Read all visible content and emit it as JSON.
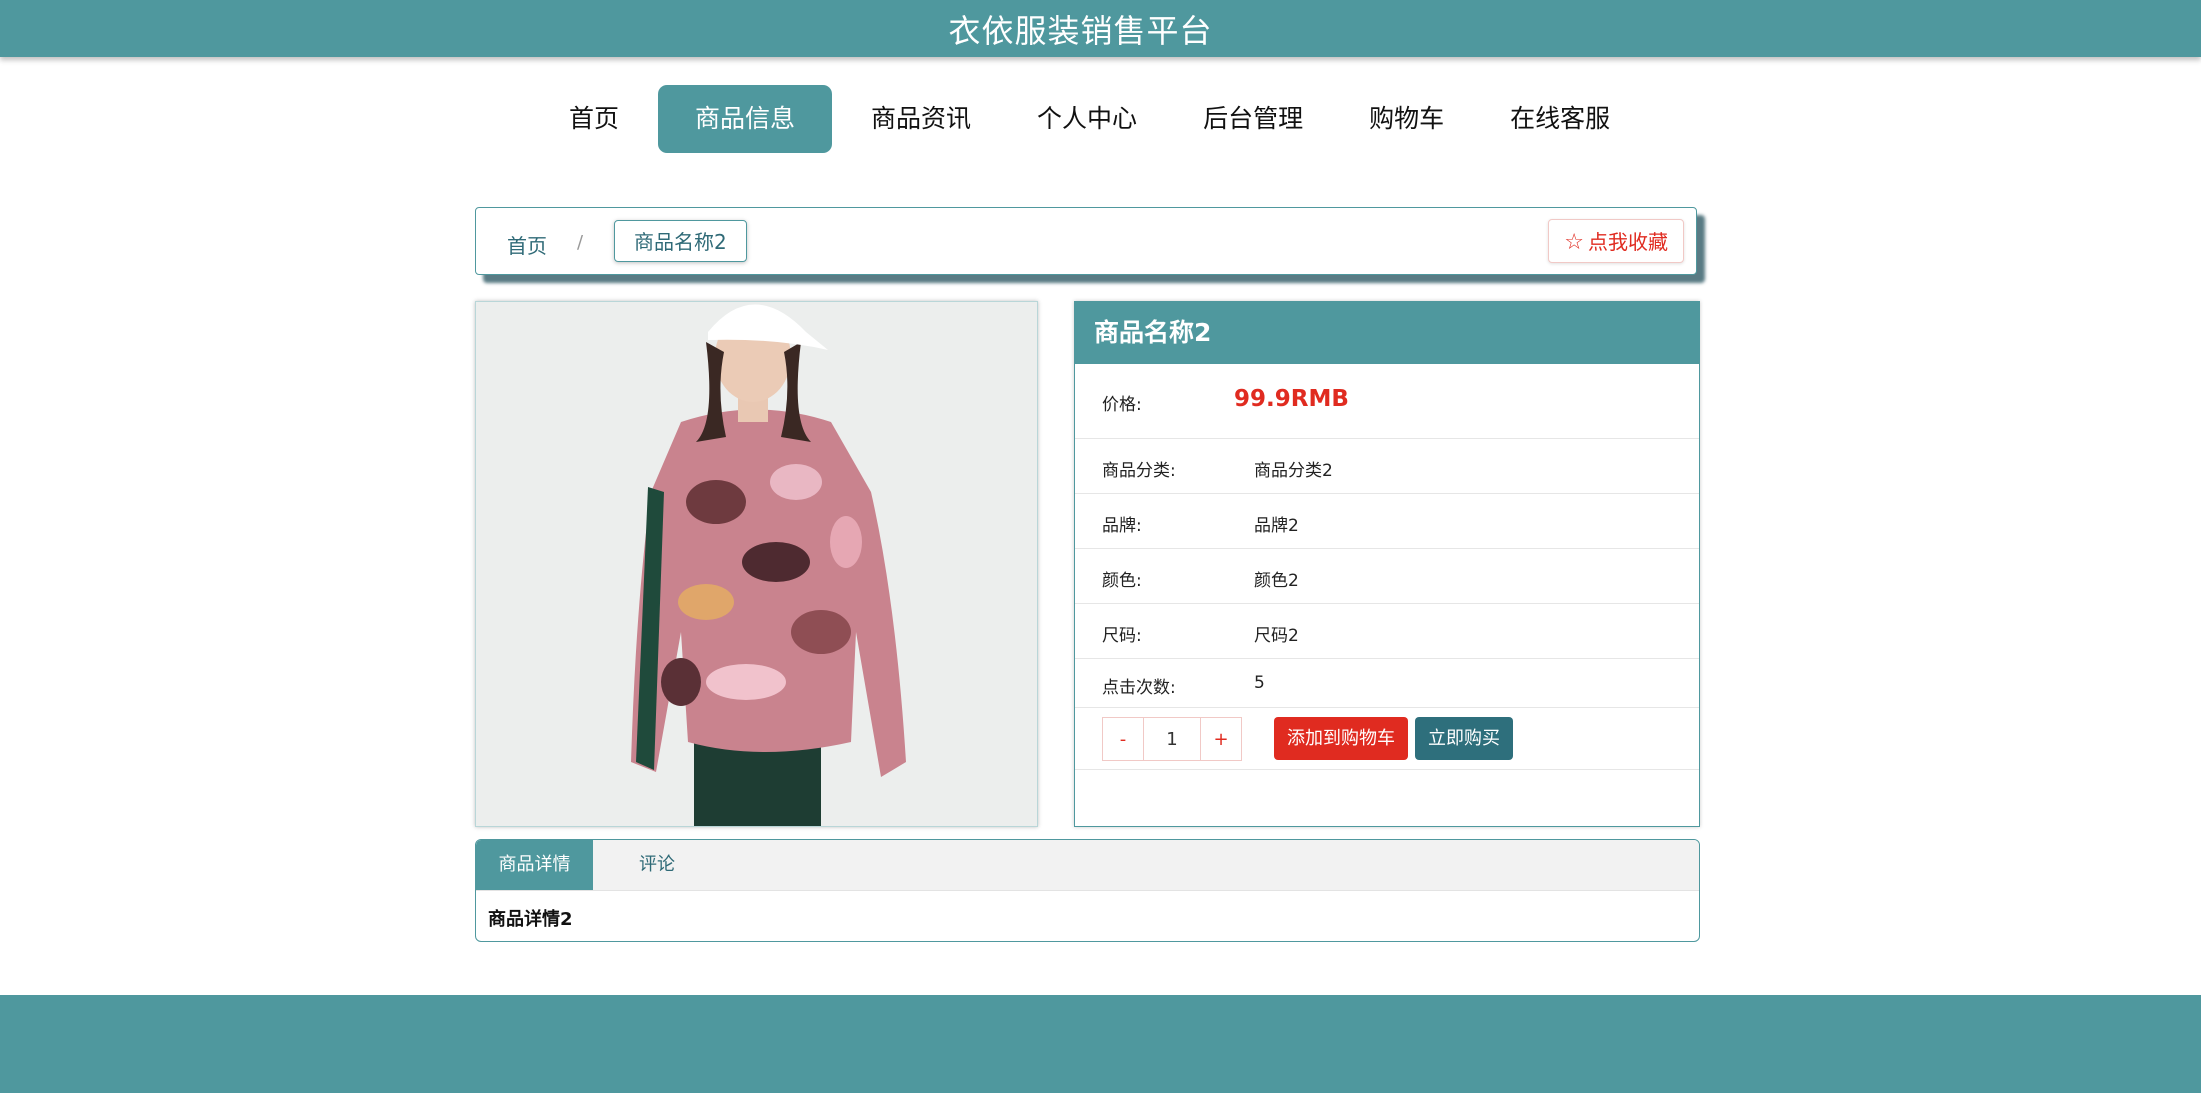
{
  "site": {
    "title": "衣依服装销售平台"
  },
  "nav": {
    "items": [
      {
        "label": "首页",
        "active": false
      },
      {
        "label": "商品信息",
        "active": true
      },
      {
        "label": "商品资讯",
        "active": false
      },
      {
        "label": "个人中心",
        "active": false
      },
      {
        "label": "后台管理",
        "active": false
      },
      {
        "label": "购物车",
        "active": false
      },
      {
        "label": "在线客服",
        "active": false
      }
    ]
  },
  "breadcrumb": {
    "home": "首页",
    "separator": "/",
    "current": "商品名称2"
  },
  "favorite": {
    "label": "点我收藏",
    "icon": "star-icon"
  },
  "product": {
    "name": "商品名称2",
    "price_label": "价格:",
    "price": "99.9RMB",
    "fields": [
      {
        "label": "商品分类:",
        "value": "商品分类2"
      },
      {
        "label": "品牌:",
        "value": "品牌2"
      },
      {
        "label": "颜色:",
        "value": "颜色2"
      },
      {
        "label": "尺码:",
        "value": "尺码2"
      }
    ],
    "clicks_label": "点击次数:",
    "clicks": "5"
  },
  "quantity": {
    "minus": "-",
    "value": "1",
    "plus": "+"
  },
  "actions": {
    "add_to_cart": "添加到购物车",
    "buy_now": "立即购买"
  },
  "tabs": {
    "items": [
      {
        "label": "商品详情"
      },
      {
        "label": "评论"
      }
    ],
    "content": "商品详情2"
  },
  "colors": {
    "primary": "#4f989e",
    "accent_red": "#e02b20",
    "dark_teal": "#2e6f7c"
  }
}
